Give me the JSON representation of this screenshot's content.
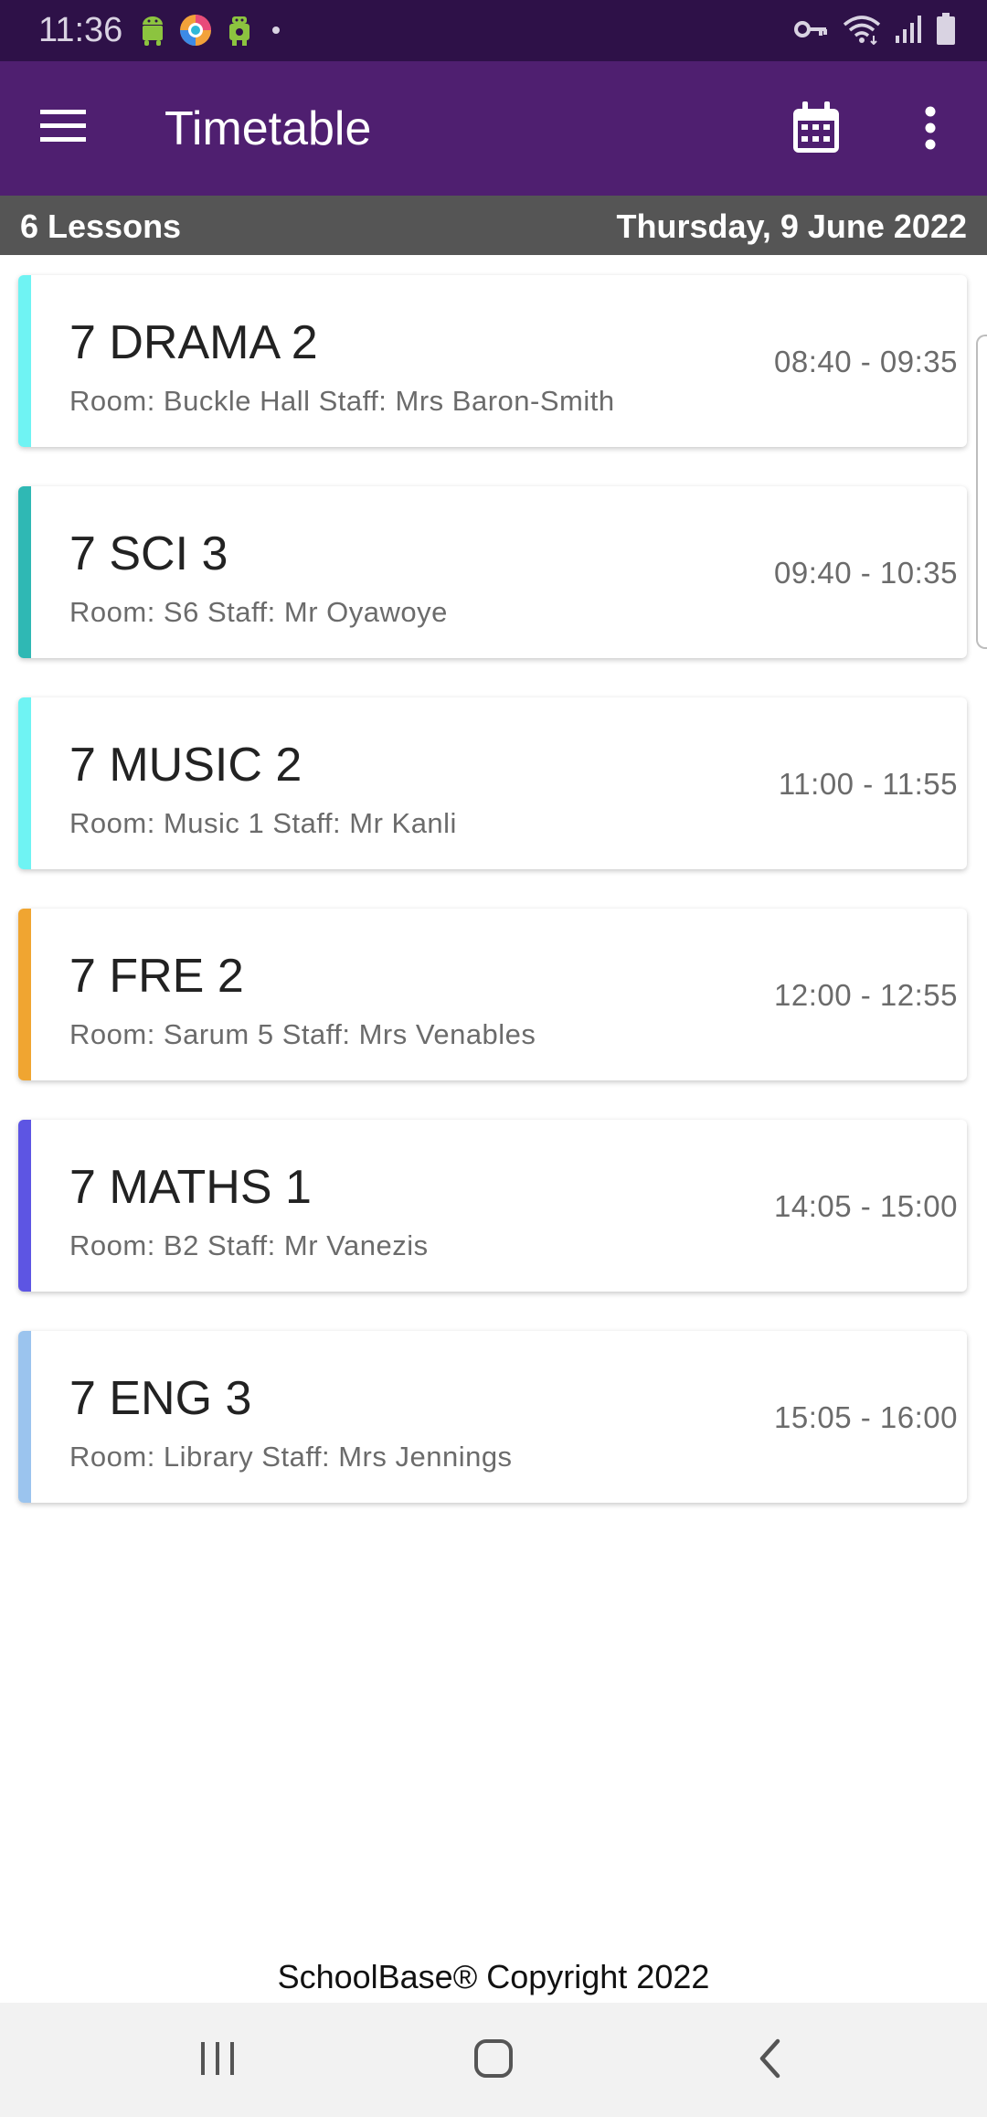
{
  "status_bar": {
    "time": "11:36",
    "left_icons": [
      "android-icon",
      "browser-icon",
      "android-robot-icon",
      "dot-icon"
    ],
    "right_icons": [
      "vpn-key-icon",
      "wifi-icon",
      "signal-icon",
      "battery-icon"
    ]
  },
  "app_bar": {
    "title": "Timetable",
    "menu_icon": "hamburger-menu-icon",
    "calendar_icon": "calendar-icon",
    "more_icon": "more-vertical-icon"
  },
  "sub_header": {
    "lesson_count": "6 Lessons",
    "date": "Thursday, 9 June 2022"
  },
  "lessons": [
    {
      "subject": "7 DRAMA 2",
      "details": "Room: Buckle Hall Staff: Mrs Baron-Smith",
      "time": "08:40 - 09:35",
      "color": "#6ff3f3"
    },
    {
      "subject": "7 SCI 3",
      "details": "Room: S6 Staff: Mr Oyawoye",
      "time": "09:40 - 10:35",
      "color": "#2fb8b4"
    },
    {
      "subject": "7 MUSIC 2",
      "details": "Room: Music 1 Staff: Mr Kanli",
      "time": "11:00 - 11:55",
      "color": "#6ff3f3"
    },
    {
      "subject": "7 FRE 2",
      "details": "Room: Sarum 5 Staff: Mrs Venables",
      "time": "12:00 - 12:55",
      "color": "#f0a531"
    },
    {
      "subject": "7 MATHS 1",
      "details": "Room: B2 Staff: Mr Vanezis",
      "time": "14:05 - 15:00",
      "color": "#5d55e3"
    },
    {
      "subject": "7 ENG 3",
      "details": "Room: Library Staff: Mrs Jennings",
      "time": "15:05 - 16:00",
      "color": "#9bc4ee"
    }
  ],
  "footer": {
    "copyright": "SchoolBase® Copyright 2022"
  },
  "nav_bar": {
    "recents_icon": "recents-icon",
    "home_icon": "home-icon",
    "back_icon": "back-icon"
  },
  "colors": {
    "status_bar": "#2e1148",
    "app_bar": "#4f1f70",
    "sub_header": "#555555",
    "nav_bar": "#f2f2f2"
  }
}
